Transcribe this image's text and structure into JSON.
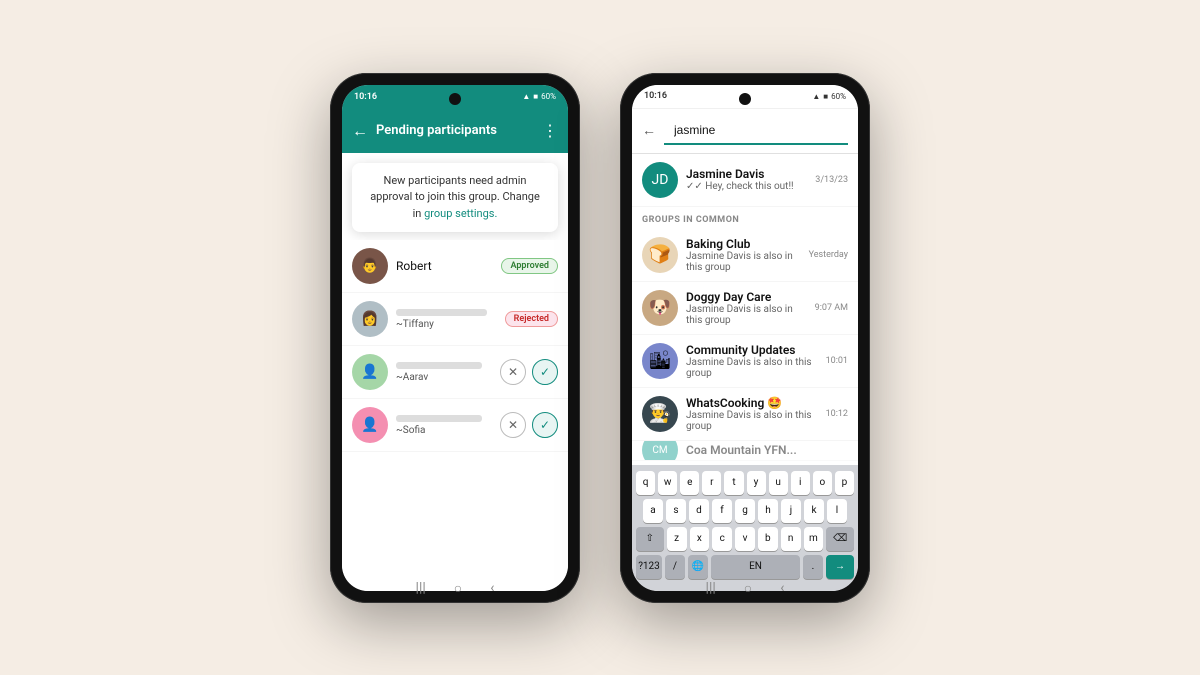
{
  "page": {
    "background": "#f5ede4"
  },
  "phone1": {
    "statusBar": {
      "time": "10:16",
      "icons": "▲ ■ 60%"
    },
    "header": {
      "title": "Pending participants",
      "backLabel": "←",
      "moreLabel": "⋮"
    },
    "tooltip": {
      "text": "New participants need admin approval to join this group. Change in",
      "linkText": "group settings.",
      "period": ""
    },
    "participants": [
      {
        "name": "Robert",
        "badge": "Approved",
        "hasAvatar": true
      },
      {
        "name": "~Tiffany",
        "badge": "Rejected",
        "hasAvatar": false
      },
      {
        "name": "~Aarav",
        "badge": "",
        "hasAvatar": false,
        "actions": true
      },
      {
        "name": "~Sofia",
        "badge": "",
        "hasAvatar": false,
        "actions": true
      }
    ],
    "navButtons": [
      "|||",
      "○",
      "‹"
    ]
  },
  "phone2": {
    "statusBar": {
      "time": "10:16",
      "icons": "▲ ■ 60%"
    },
    "search": {
      "backLabel": "←",
      "placeholder": "jasmine",
      "value": "jasmine"
    },
    "contact": {
      "name": "Jasmine Davis",
      "status": "✓✓ Hey, check this out!!",
      "time": "3/13/23"
    },
    "sectionHeader": "GROUPS IN COMMON",
    "groups": [
      {
        "emoji": "🍞🥐",
        "bg": "#e8d5b7",
        "name": "Baking Club",
        "time": "Yesterday",
        "sub": "Jasmine Davis is also in this group"
      },
      {
        "emoji": "🐶",
        "bg": "#c8a882",
        "name": "Doggy Day Care",
        "time": "9:07 AM",
        "sub": "Jasmine Davis is also in this group"
      },
      {
        "emoji": "🏙",
        "bg": "#7986cb",
        "name": "Community Updates",
        "time": "10:01",
        "sub": "Jasmine Davis is also in this group"
      },
      {
        "emoji": "👨‍🍳",
        "bg": "#37474f",
        "name": "WhatsCooking 🤩",
        "time": "10:12",
        "sub": "Jasmine Davis is also in this group"
      }
    ],
    "keyboard": {
      "row1": [
        "q",
        "w",
        "e",
        "r",
        "t",
        "y",
        "u",
        "i",
        "o",
        "p"
      ],
      "row2": [
        "a",
        "s",
        "d",
        "f",
        "g",
        "h",
        "j",
        "k",
        "l"
      ],
      "row3": [
        "z",
        "x",
        "c",
        "v",
        "b",
        "n",
        "m"
      ],
      "extras": [
        "?123",
        "/",
        "🌐",
        "EN",
        ".",
        "→"
      ]
    },
    "navButtons": [
      "|||",
      "○",
      "‹"
    ]
  }
}
